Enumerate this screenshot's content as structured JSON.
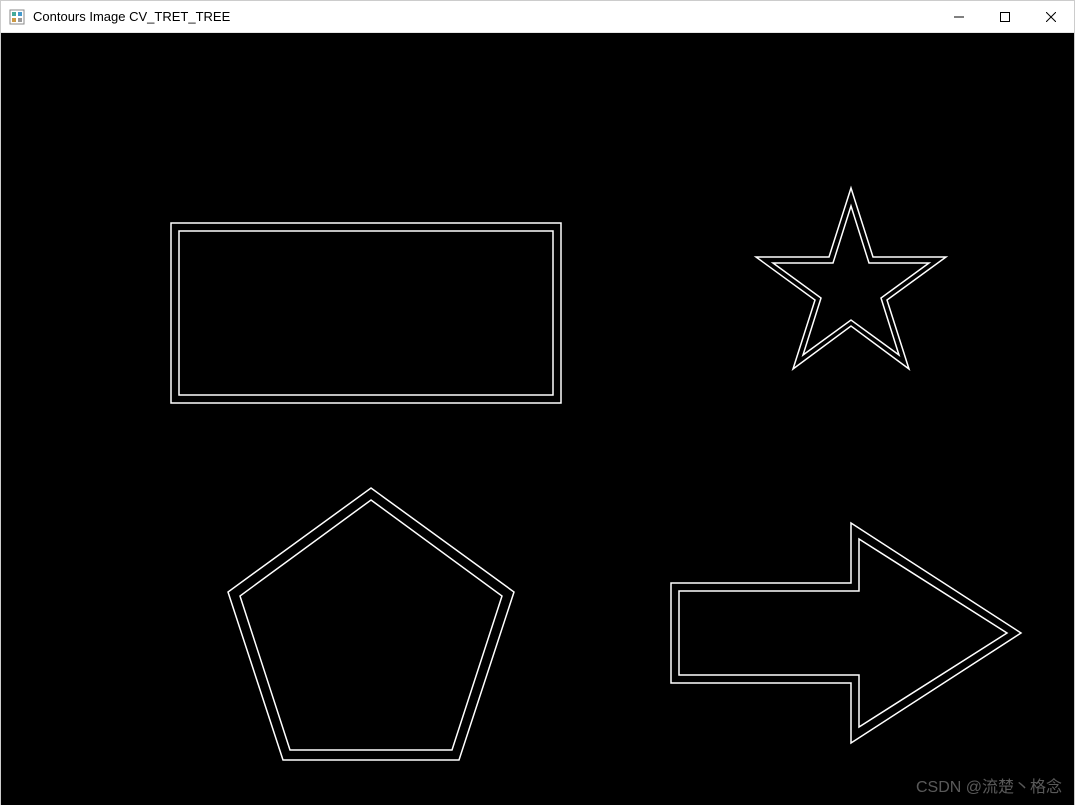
{
  "window": {
    "title": "Contours Image CV_TRET_TREE"
  },
  "shapes": {
    "rectangle": {
      "name": "rectangle-contour"
    },
    "star": {
      "name": "star-contour"
    },
    "pentagon": {
      "name": "pentagon-contour"
    },
    "arrow": {
      "name": "arrow-contour"
    }
  },
  "watermark": "CSDN @流楚丶格念"
}
